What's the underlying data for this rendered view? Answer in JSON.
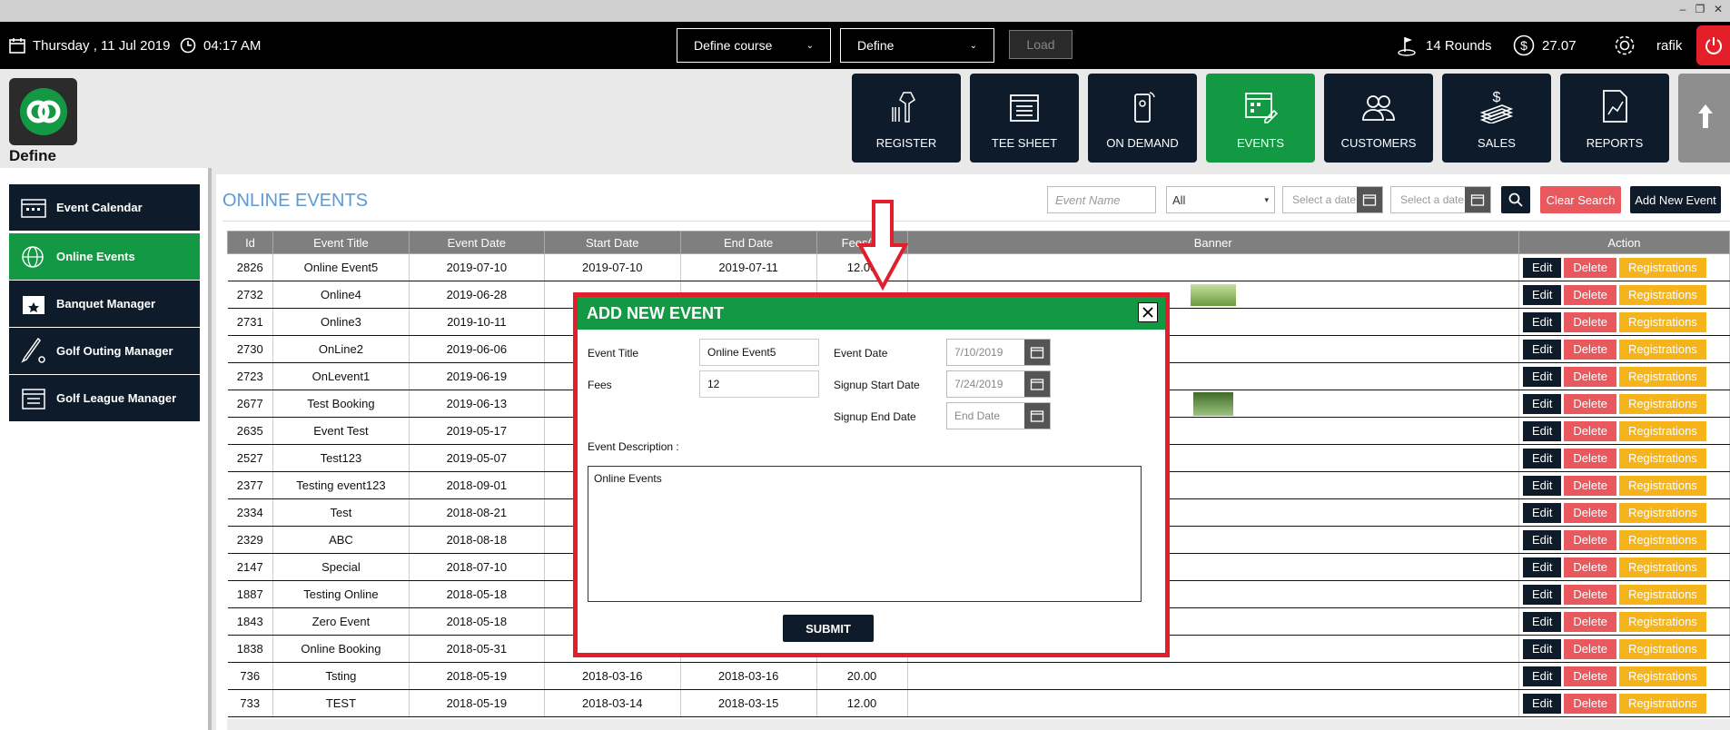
{
  "window": {
    "minimize": "–",
    "restore": "❐",
    "close": "✕"
  },
  "topbar": {
    "date": "Thursday ,  11 Jul 2019",
    "time": "04:17 AM",
    "course_select": "Define course",
    "define_select": "Define",
    "load_label": "Load",
    "rounds": "14 Rounds",
    "balance": "27.07",
    "user": "rafik"
  },
  "brand": {
    "name": "Define"
  },
  "nav": [
    {
      "label": "REGISTER",
      "icon": "barcode-scanner-icon"
    },
    {
      "label": "TEE SHEET",
      "icon": "calendar-sheet-icon"
    },
    {
      "label": "ON DEMAND",
      "icon": "phone-icon"
    },
    {
      "label": "EVENTS",
      "icon": "events-calendar-icon"
    },
    {
      "label": "CUSTOMERS",
      "icon": "users-icon"
    },
    {
      "label": "SALES",
      "icon": "money-icon"
    },
    {
      "label": "REPORTS",
      "icon": "report-icon"
    }
  ],
  "sidebar": {
    "items": [
      {
        "label": "Event Calendar"
      },
      {
        "label": "Online Events"
      },
      {
        "label": "Banquet Manager"
      },
      {
        "label": "Golf Outing Manager"
      },
      {
        "label": "Golf League Manager"
      }
    ]
  },
  "page": {
    "title": "ONLINE EVENTS",
    "event_name_placeholder": "Event Name",
    "filter_select": "All",
    "date_placeholder_1": "Select a date",
    "date_placeholder_2": "Select a date",
    "clear_search": "Clear Search",
    "add_new_event": "Add New Event"
  },
  "table": {
    "headers": [
      "Id",
      "Event Title",
      "Event Date",
      "Start Date",
      "End Date",
      "Fees($)",
      "Banner",
      "Action"
    ],
    "actions": {
      "edit": "Edit",
      "delete": "Delete",
      "registrations": "Registrations"
    },
    "rows": [
      {
        "id": "2826",
        "title": "Online Event5",
        "event_date": "2019-07-10",
        "start": "2019-07-10",
        "end": "2019-07-11",
        "fees": "12.00",
        "banner": ""
      },
      {
        "id": "2732",
        "title": "Online4",
        "event_date": "2019-06-28",
        "start": "",
        "end": "",
        "fees": "",
        "banner": "golf-course-thumbnail"
      },
      {
        "id": "2731",
        "title": "Online3",
        "event_date": "2019-10-11",
        "start": "",
        "end": "",
        "fees": "",
        "banner": ""
      },
      {
        "id": "2730",
        "title": "OnLine2",
        "event_date": "2019-06-06",
        "start": "",
        "end": "",
        "fees": "",
        "banner": ""
      },
      {
        "id": "2723",
        "title": "OnLevent1",
        "event_date": "2019-06-19",
        "start": "",
        "end": "",
        "fees": "",
        "banner": ""
      },
      {
        "id": "2677",
        "title": "Test Booking",
        "event_date": "2019-06-13",
        "start": "",
        "end": "",
        "fees": "",
        "banner": "golf-cart-thumbnail"
      },
      {
        "id": "2635",
        "title": "Event Test",
        "event_date": "2019-05-17",
        "start": "",
        "end": "",
        "fees": "",
        "banner": ""
      },
      {
        "id": "2527",
        "title": "Test123",
        "event_date": "2019-05-07",
        "start": "",
        "end": "",
        "fees": "",
        "banner": ""
      },
      {
        "id": "2377",
        "title": "Testing event123",
        "event_date": "2018-09-01",
        "start": "",
        "end": "",
        "fees": "",
        "banner": ""
      },
      {
        "id": "2334",
        "title": "Test",
        "event_date": "2018-08-21",
        "start": "",
        "end": "",
        "fees": "",
        "banner": ""
      },
      {
        "id": "2329",
        "title": "ABC",
        "event_date": "2018-08-18",
        "start": "",
        "end": "",
        "fees": "",
        "banner": ""
      },
      {
        "id": "2147",
        "title": "Special",
        "event_date": "2018-07-10",
        "start": "",
        "end": "",
        "fees": "",
        "banner": ""
      },
      {
        "id": "1887",
        "title": "Testing Online",
        "event_date": "2018-05-18",
        "start": "",
        "end": "",
        "fees": "",
        "banner": ""
      },
      {
        "id": "1843",
        "title": "Zero Event",
        "event_date": "2018-05-18",
        "start": "",
        "end": "",
        "fees": "",
        "banner": ""
      },
      {
        "id": "1838",
        "title": "Online Booking",
        "event_date": "2018-05-31",
        "start": "",
        "end": "",
        "fees": "",
        "banner": ""
      },
      {
        "id": "736",
        "title": "Tsting",
        "event_date": "2018-05-19",
        "start": "2018-03-16",
        "end": "2018-03-16",
        "fees": "20.00",
        "banner": ""
      },
      {
        "id": "733",
        "title": "TEST",
        "event_date": "2018-05-19",
        "start": "2018-03-14",
        "end": "2018-03-15",
        "fees": "12.00",
        "banner": ""
      }
    ]
  },
  "modal": {
    "title": "ADD NEW EVENT",
    "event_title_label": "Event Title",
    "event_title_value": "Online Event5",
    "fees_label": "Fees",
    "fees_value": "12",
    "event_date_label": "Event Date",
    "event_date_value": "7/10/2019",
    "signup_start_label": "Signup Start Date",
    "signup_start_value": "7/24/2019",
    "signup_end_label": "Signup End Date",
    "signup_end_placeholder": "End Date",
    "description_label": "Event Description :",
    "description_value": "Online Events",
    "submit": "SUBMIT"
  },
  "colors": {
    "accent_green": "#139943",
    "navy": "#0d1b2a",
    "highlight_red": "#e21d2c",
    "delete": "#e9585d",
    "registrations": "#f5b41a",
    "title_blue": "#5a9bd5"
  }
}
